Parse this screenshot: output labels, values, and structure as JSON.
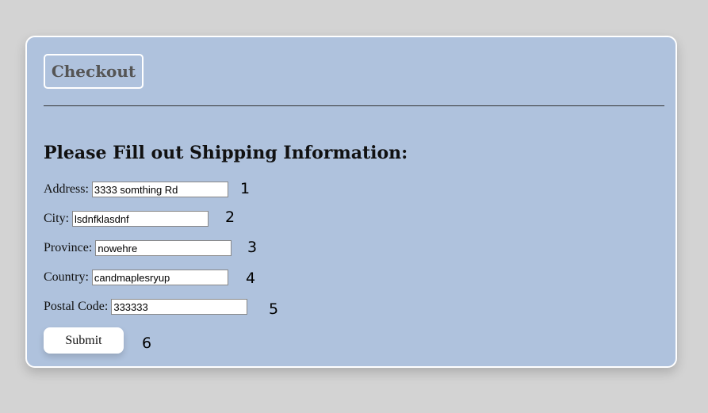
{
  "page": {
    "tab_label": "Checkout",
    "heading": "Please Fill out Shipping Information:"
  },
  "form": {
    "address": {
      "label": "Address:",
      "value": "3333 somthing Rd"
    },
    "city": {
      "label": "City:",
      "value": "lsdnfklasdnf"
    },
    "province": {
      "label": "Province:",
      "value": "nowehre"
    },
    "country": {
      "label": "Country:",
      "value": "candmaplesryup"
    },
    "postal_code": {
      "label": "Postal Code:",
      "value": "333333"
    },
    "submit_label": "Submit"
  },
  "markers": [
    "1",
    "2",
    "3",
    "4",
    "5",
    "6"
  ],
  "colors": {
    "page_background": "#d3d3d3",
    "card_background": "#afc2dd",
    "card_border": "#ffffff"
  }
}
